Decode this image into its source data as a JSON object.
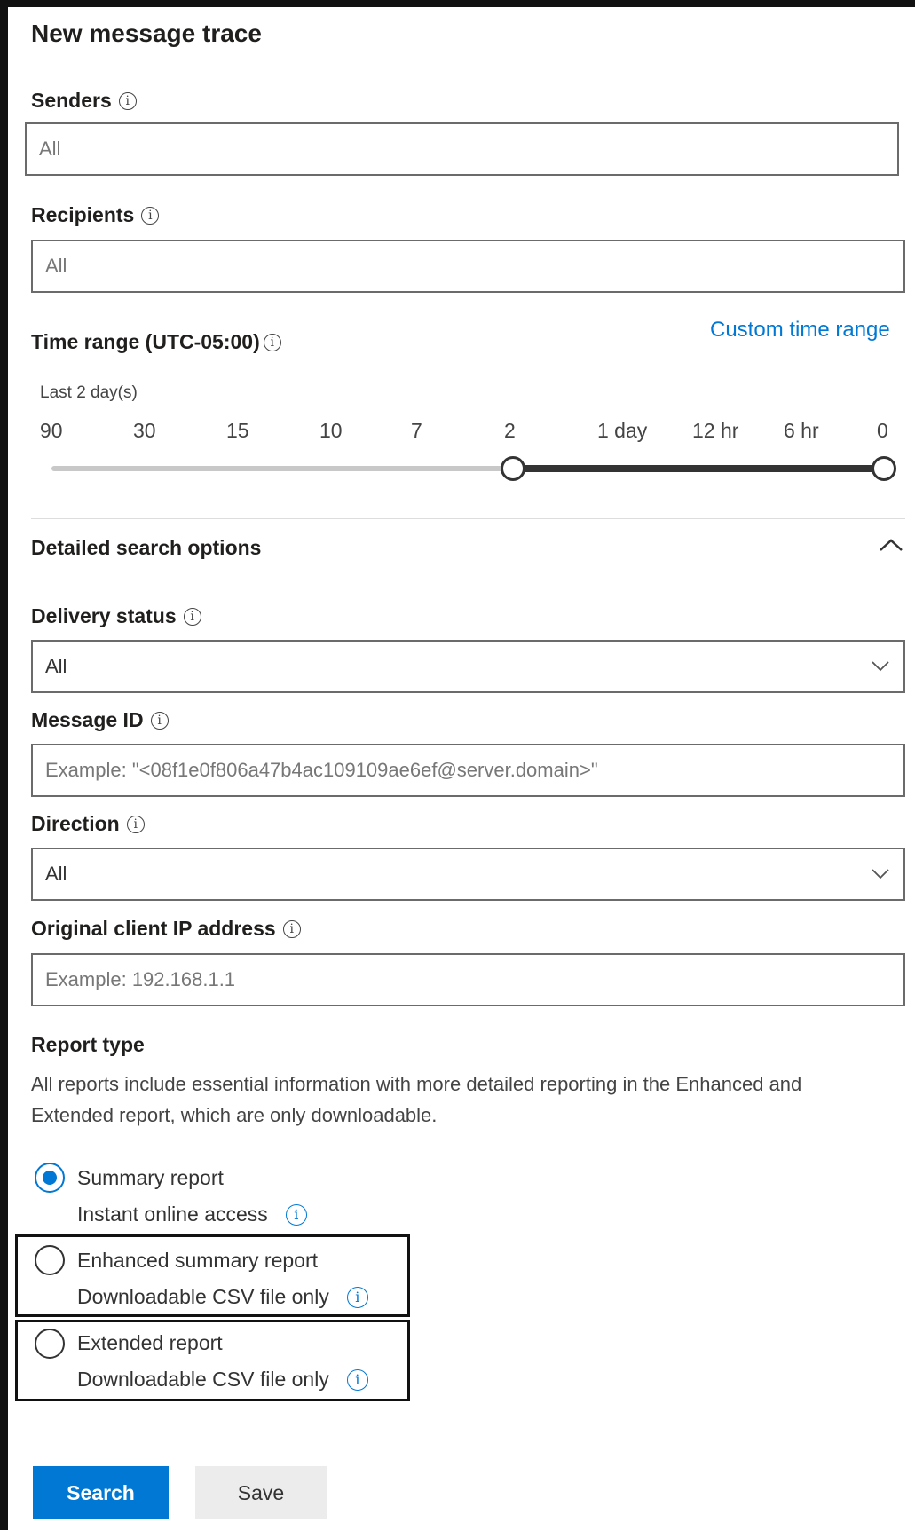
{
  "panel": {
    "title": "New message trace"
  },
  "senders": {
    "label": "Senders",
    "placeholder": "All"
  },
  "recipients": {
    "label": "Recipients",
    "placeholder": "All"
  },
  "time_range": {
    "label": "Time range (UTC-05:00)",
    "custom_link": "Custom time range",
    "selection": "Last 2 day(s)",
    "ticks": [
      "90",
      "30",
      "15",
      "10",
      "7",
      "2",
      "1 day",
      "12 hr",
      "6 hr",
      "0"
    ],
    "selected_start": "2",
    "selected_end": "0"
  },
  "detailed": {
    "header": "Detailed search options",
    "delivery_status": {
      "label": "Delivery status",
      "value": "All"
    },
    "message_id": {
      "label": "Message ID",
      "placeholder": "Example: \"<08f1e0f806a47b4ac109109ae6ef@server.domain>\""
    },
    "direction": {
      "label": "Direction",
      "value": "All"
    },
    "client_ip": {
      "label": "Original client IP address",
      "placeholder": "Example: 192.168.1.1"
    }
  },
  "report_type": {
    "label": "Report type",
    "description": "All reports include essential information with more detailed reporting in the Enhanced and Extended report, which are only downloadable.",
    "options": [
      {
        "label": "Summary report",
        "sublabel": "Instant online access",
        "selected": true
      },
      {
        "label": "Enhanced summary report",
        "sublabel": "Downloadable CSV file only",
        "selected": false
      },
      {
        "label": "Extended report",
        "sublabel": "Downloadable CSV file only",
        "selected": false
      }
    ]
  },
  "actions": {
    "search": "Search",
    "save": "Save"
  },
  "colors": {
    "accent": "#0078d4",
    "border": "#6b6b6b",
    "text": "#201f1e"
  }
}
